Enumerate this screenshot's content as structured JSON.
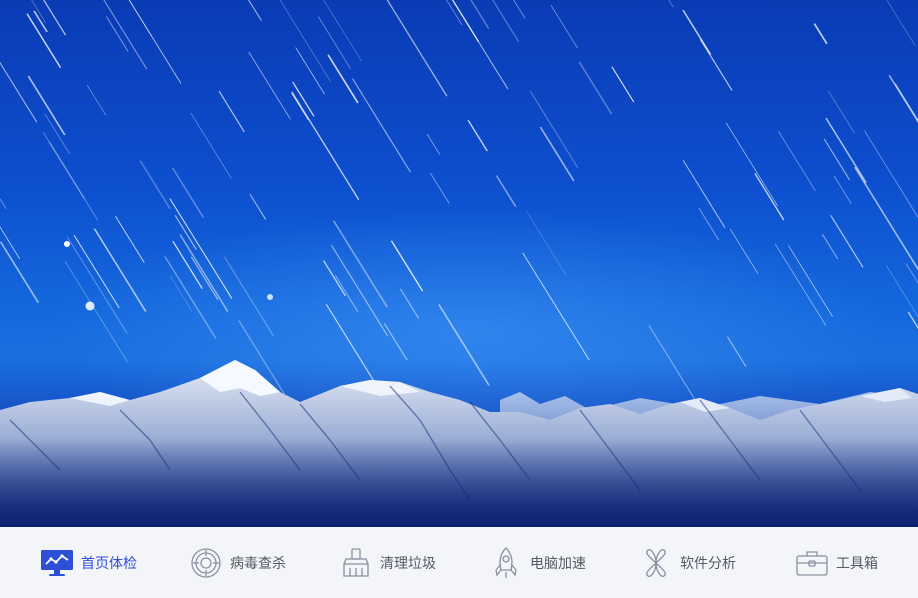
{
  "hero": {
    "background_colors": {
      "sky_top": "#0a3bb5",
      "sky_mid": "#1467dc",
      "sky_bottom": "#0b2a86",
      "snow": "#e8eef8"
    }
  },
  "nav": {
    "active_color": "#2d4fd6",
    "text_color": "#555a66",
    "items": [
      {
        "label": "首页体检",
        "icon": "monitor-chart-icon",
        "active": true
      },
      {
        "label": "病毒查杀",
        "icon": "target-icon",
        "active": false
      },
      {
        "label": "清理垃圾",
        "icon": "broom-icon",
        "active": false
      },
      {
        "label": "电脑加速",
        "icon": "rocket-icon",
        "active": false
      },
      {
        "label": "软件分析",
        "icon": "clover-icon",
        "active": false
      },
      {
        "label": "工具箱",
        "icon": "toolbox-icon",
        "active": false
      }
    ]
  }
}
